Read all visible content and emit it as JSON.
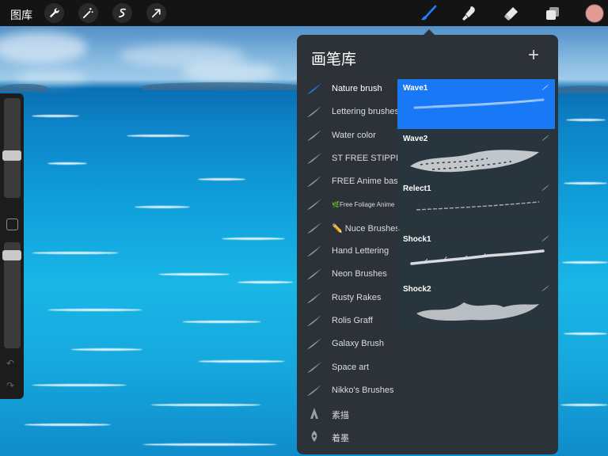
{
  "topbar": {
    "gallery_label": "图库",
    "left_tools": [
      "wrench-icon",
      "magic-wand-icon",
      "selection-icon",
      "transform-arrow-icon"
    ],
    "right_tools": [
      "brush-icon",
      "smudge-icon",
      "eraser-icon",
      "layers-icon"
    ],
    "active_tool": "brush-icon",
    "current_color": "#e29a95"
  },
  "sidebar": {
    "brush_size_level": 0.58,
    "opacity_level": 0.08,
    "undo_icon": "undo-icon",
    "redo_icon": "redo-icon"
  },
  "brush_library": {
    "title": "画笔库",
    "add_icon": "plus-icon",
    "accent_color": "#1878f5",
    "sets": [
      {
        "label": "Nature brush",
        "active": true
      },
      {
        "label": "Lettering brushes"
      },
      {
        "label": "Water color"
      },
      {
        "label": "ST FREE STIPPLE"
      },
      {
        "label": "FREE Anime basic"
      },
      {
        "label": "🌿Free Foliage Anime"
      },
      {
        "label": "✏️ Nuce Brushes"
      },
      {
        "label": "Hand Lettering"
      },
      {
        "label": "Neon Brushes"
      },
      {
        "label": "Rusty Rakes"
      },
      {
        "label": "Rolis Graff"
      },
      {
        "label": "Galaxy Brush"
      },
      {
        "label": "Space art"
      },
      {
        "label": "Nikko's Brushes"
      },
      {
        "label": "素描"
      },
      {
        "label": "着墨"
      }
    ],
    "brushes": [
      {
        "name": "Wave1",
        "selected": true
      },
      {
        "name": "Wave2"
      },
      {
        "name": "Relect1"
      },
      {
        "name": "Shock1"
      },
      {
        "name": "Shock2"
      }
    ]
  }
}
